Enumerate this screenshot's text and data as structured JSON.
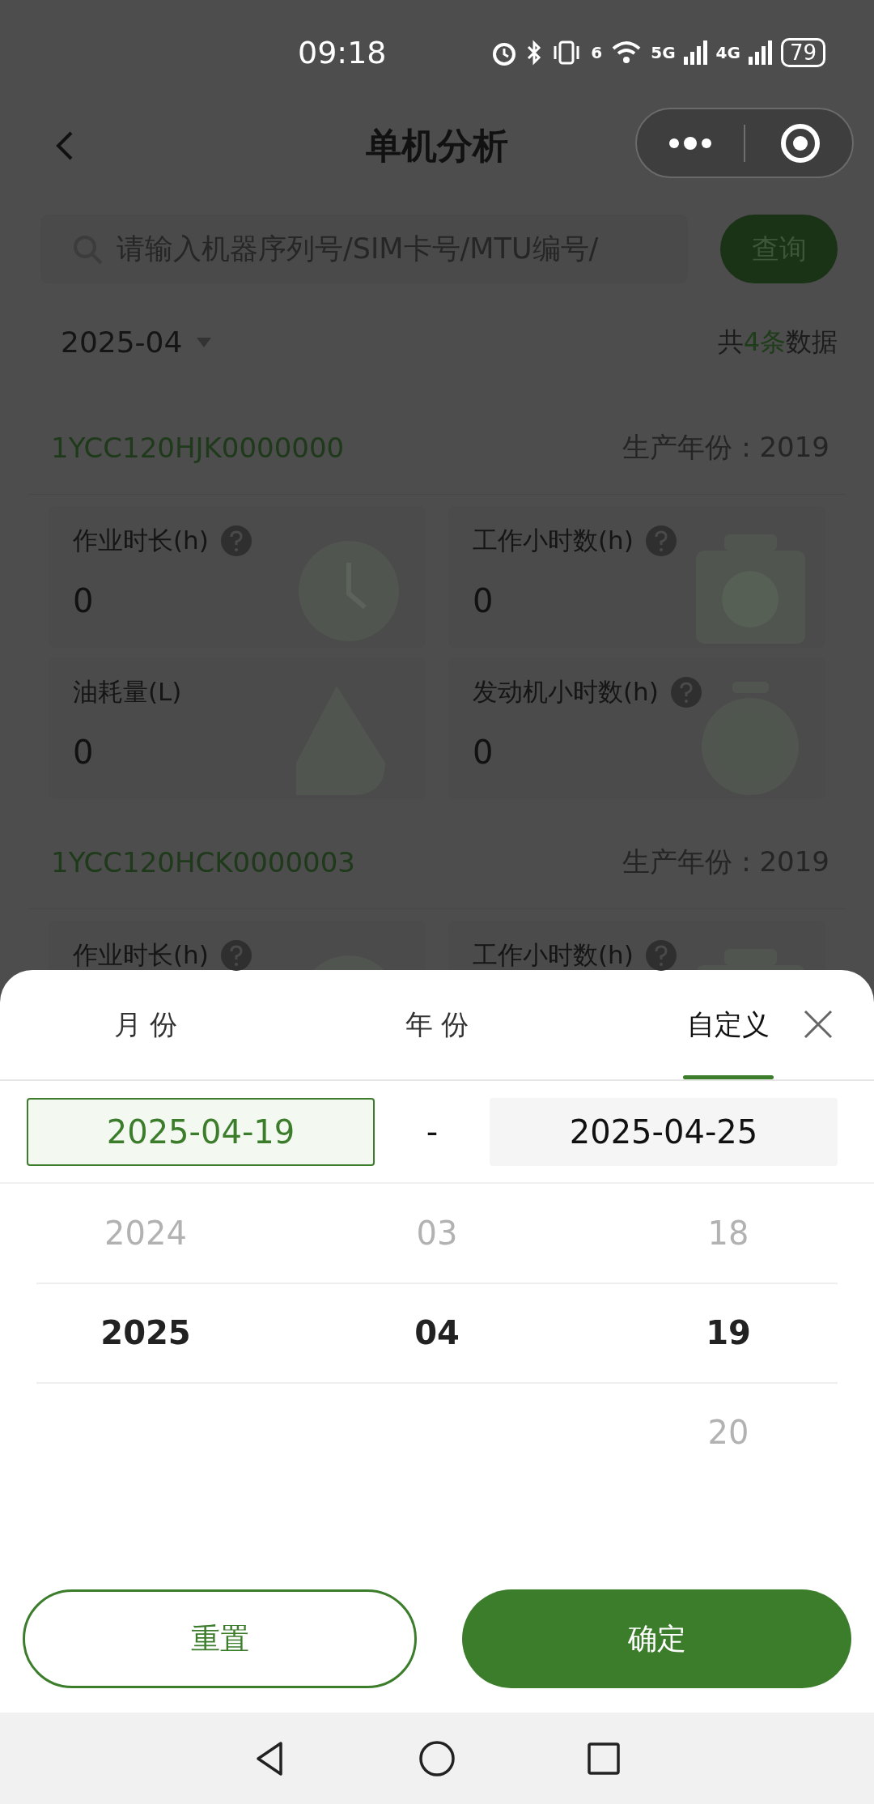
{
  "status_bar": {
    "time": "09:18",
    "wifi_label": "6",
    "sim1_label": "5G",
    "sim2_label": "4G",
    "battery": "79"
  },
  "nav": {
    "title": "单机分析"
  },
  "search": {
    "placeholder": "请输入机器序列号/SIM卡号/MTU编号/",
    "button": "查询"
  },
  "filter": {
    "month": "2025-04",
    "count_prefix": "共",
    "count": "4条",
    "count_suffix": "数据"
  },
  "machines": [
    {
      "serial": "1YCC120HJK0000000",
      "year": "生产年份 : 2019",
      "metrics": [
        {
          "label": "作业时长(h)",
          "help": true,
          "value": "0",
          "kind": "clock"
        },
        {
          "label": "工作小时数(h)",
          "help": true,
          "value": "0",
          "kind": "timer"
        },
        {
          "label": "油耗量(L)",
          "help": false,
          "value": "0",
          "kind": "fuel"
        },
        {
          "label": "发动机小时数(h)",
          "help": true,
          "value": "0",
          "kind": "stopwatch"
        }
      ]
    },
    {
      "serial": "1YCC120HCK0000003",
      "year": "生产年份 : 2019",
      "metrics": [
        {
          "label": "作业时长(h)",
          "help": true,
          "kind": "clock"
        },
        {
          "label": "工作小时数(h)",
          "help": true,
          "kind": "timer"
        }
      ]
    }
  ],
  "sheet": {
    "tabs": [
      {
        "label": "月 份",
        "selected": false
      },
      {
        "label": "年 份",
        "selected": false
      },
      {
        "label": "自定义",
        "selected": true
      }
    ],
    "start": {
      "value": "2025-04-19",
      "selected": true
    },
    "separator": "-",
    "end": {
      "value": "2025-04-25",
      "selected": false
    },
    "picker": [
      {
        "items": [
          {
            "text": "2024",
            "selected": false
          },
          {
            "text": "2025",
            "selected": true
          }
        ]
      },
      {
        "items": [
          {
            "text": "03",
            "selected": false
          },
          {
            "text": "04",
            "selected": true
          }
        ]
      },
      {
        "items": [
          {
            "text": "18",
            "selected": false
          },
          {
            "text": "19",
            "selected": true
          },
          {
            "text": "20",
            "selected": false
          }
        ]
      }
    ],
    "reset": "重置",
    "confirm": "确定"
  }
}
